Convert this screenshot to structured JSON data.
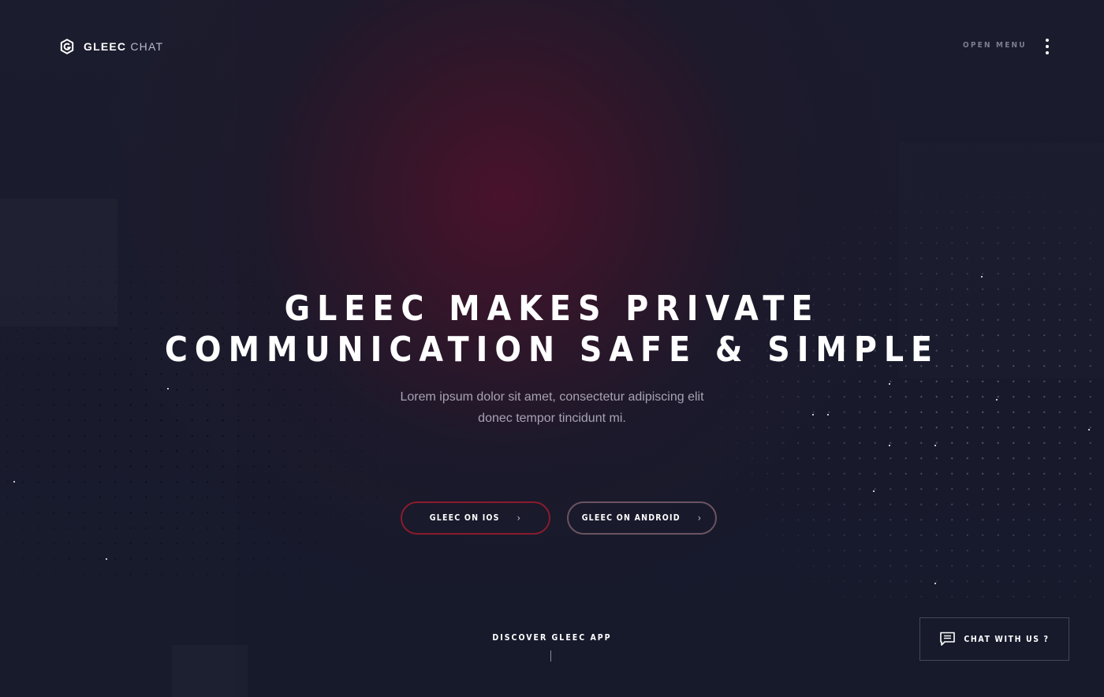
{
  "brand": {
    "name_bold": "GLEEC",
    "name_light": "CHAT",
    "logo_icon": "gleec-g-logo"
  },
  "header": {
    "menu_label": "OPEN MENU",
    "menu_icon": "kebab-menu-icon"
  },
  "hero": {
    "title_lines": [
      "GLEEC MAKES PRIVATE",
      "COMMUNICATION SAFE & SIMPLE"
    ],
    "subtitle_lines": [
      "Lorem ipsum dolor sit amet, consectetur adipiscing elit",
      "donec tempor tincidunt mi."
    ]
  },
  "buttons": {
    "ios": {
      "label": "GLEEC ON IOS",
      "icon": "chevron-right-icon"
    },
    "android": {
      "label": "GLEEC ON ANDROID",
      "icon": "chevron-right-icon"
    }
  },
  "discover": {
    "label": "DISCOVER GLEEC APP"
  },
  "chat": {
    "label": "CHAT WITH US ?",
    "icon": "chat-bubble-icon"
  },
  "colors": {
    "background": "#171a2b",
    "glow": "#4c122c",
    "ios_border": "#8a1b2c",
    "android_border": "#6b5362",
    "muted_text": "#a8a3b3"
  }
}
